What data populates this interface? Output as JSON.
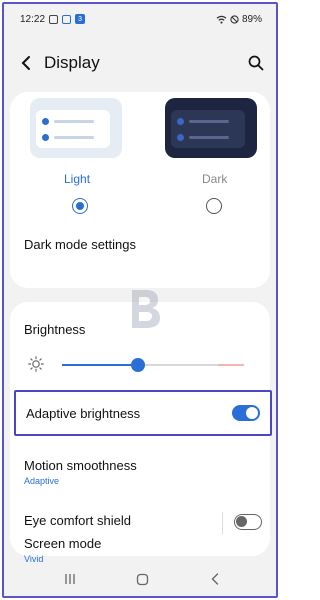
{
  "status_bar": {
    "time": "12:22",
    "notif_badge": "3",
    "battery": "89%"
  },
  "header": {
    "title": "Display"
  },
  "theme": {
    "light_label": "Light",
    "dark_label": "Dark",
    "selected": "Light",
    "dark_mode_settings": "Dark mode settings"
  },
  "brightness": {
    "title": "Brightness",
    "level": 0.42
  },
  "adaptive_brightness": {
    "label": "Adaptive brightness",
    "enabled": true
  },
  "motion_smoothness": {
    "title": "Motion smoothness",
    "value": "Adaptive"
  },
  "eye_comfort": {
    "title": "Eye comfort shield",
    "enabled": false
  },
  "screen_mode": {
    "title": "Screen mode",
    "value": "Vivid"
  },
  "colors": {
    "accent": "#2a6fd6",
    "highlight_border": "#4b47c2"
  }
}
